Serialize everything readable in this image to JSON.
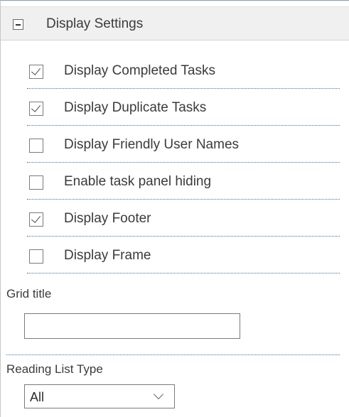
{
  "section": {
    "title": "Display Settings",
    "collapse_icon": "minus-box-icon"
  },
  "options": [
    {
      "label": "Display Completed Tasks",
      "checked": true
    },
    {
      "label": "Display Duplicate Tasks",
      "checked": true
    },
    {
      "label": "Display Friendly User Names",
      "checked": false
    },
    {
      "label": "Enable task panel hiding",
      "checked": false
    },
    {
      "label": "Display Footer",
      "checked": true
    },
    {
      "label": "Display Frame",
      "checked": false
    }
  ],
  "grid_title": {
    "label": "Grid title",
    "value": ""
  },
  "reading_list": {
    "label": "Reading List Type",
    "selected": "All",
    "icon": "chevron-down-icon"
  },
  "colors": {
    "header_bg": "#f0f0f0",
    "divider": "#3d6fb5",
    "text": "#3b3b3b"
  }
}
